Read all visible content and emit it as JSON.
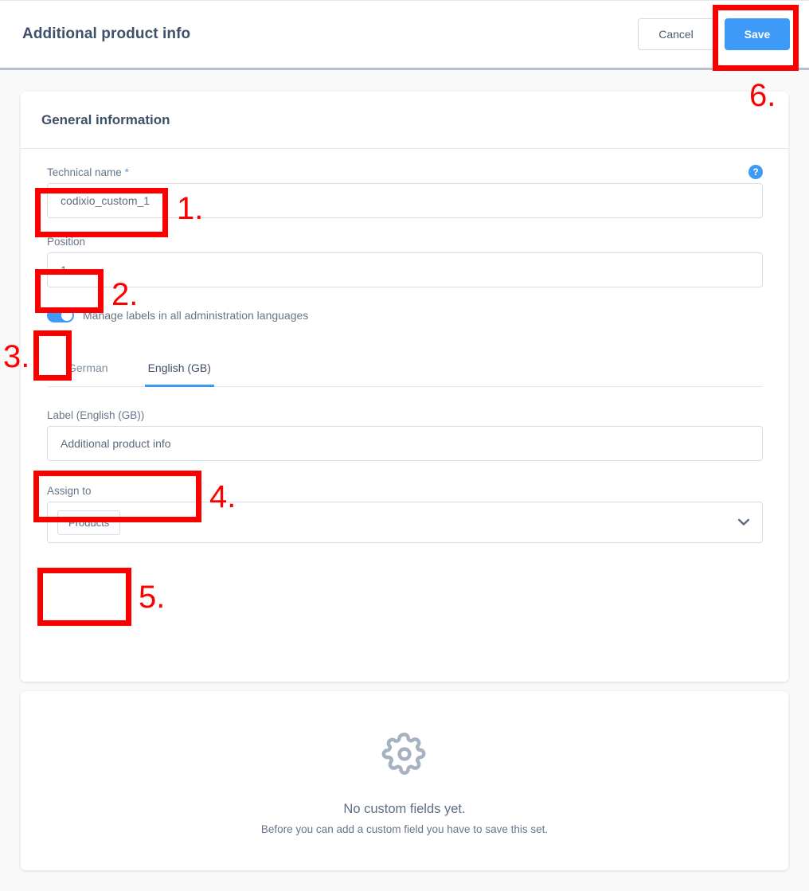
{
  "header": {
    "title": "Additional product info",
    "cancel_label": "Cancel",
    "save_label": "Save"
  },
  "general_card": {
    "title": "General information",
    "technical_name": {
      "label": "Technical name",
      "required_marker": "*",
      "value": "codixio_custom_1",
      "help_icon_glyph": "?"
    },
    "position": {
      "label": "Position",
      "value": "1"
    },
    "manage_labels_toggle": {
      "label": "Manage labels in all administration languages",
      "state": "on"
    },
    "language_tabs": [
      {
        "label": "German",
        "active": false
      },
      {
        "label": "English (GB)",
        "active": true
      }
    ],
    "label_field": {
      "label": "Label (English (GB))",
      "value": "Additional product info"
    },
    "assign_to": {
      "label": "Assign to",
      "chips": [
        "Products"
      ],
      "chevron_icon": "chevron-down-icon"
    }
  },
  "custom_fields_card": {
    "icon": "gear-icon",
    "title": "No custom fields yet.",
    "subtitle": "Before you can add a custom field you have to save this set."
  },
  "annotations": [
    {
      "number": "1.",
      "target": "technical-name-input"
    },
    {
      "number": "2.",
      "target": "position-input"
    },
    {
      "number": "3.",
      "target": "manage-labels-toggle"
    },
    {
      "number": "4.",
      "target": "label-input"
    },
    {
      "number": "5.",
      "target": "assign-to-chip"
    },
    {
      "number": "6.",
      "target": "save-button"
    }
  ],
  "colors": {
    "accent": "#3d9bf7",
    "annotation": "#fc0000",
    "page_background": "#f9f9fa",
    "text_dark": "#3f5069",
    "text_muted": "#66768a"
  }
}
